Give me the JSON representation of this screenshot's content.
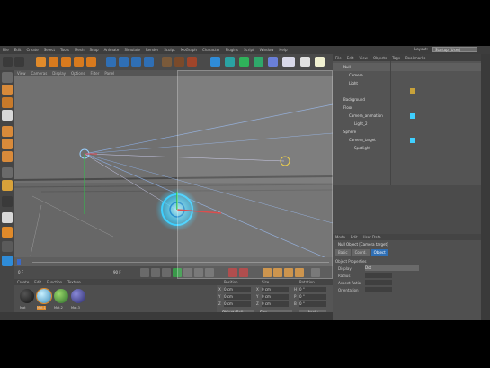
{
  "menubar": {
    "items": [
      "File",
      "Edit",
      "Create",
      "Select",
      "Tools",
      "Mesh",
      "Snap",
      "Animate",
      "Simulate",
      "Render",
      "Sculpt",
      "MoGraph",
      "Character",
      "Plugins",
      "Script",
      "Window",
      "Help"
    ],
    "layout_label": "Layout:",
    "layout_value": "Startup (User)"
  },
  "viewport": {
    "menu": [
      "View",
      "Cameras",
      "Display",
      "Options",
      "Filter",
      "Panel"
    ],
    "label": "Perspective"
  },
  "object_manager": {
    "menu": [
      "File",
      "Edit",
      "View",
      "Objects",
      "Tags",
      "Bookmarks"
    ],
    "rows": [
      "Null",
      "Camera",
      "Light",
      "Background",
      "Floor",
      "Camera_animation",
      "Light_2",
      "Sphere",
      "Camera_target",
      "Spotlight"
    ]
  },
  "attribute_manager": {
    "menu": [
      "Mode",
      "Edit",
      "User Data"
    ],
    "title": "Null Object [Camera target]",
    "tabs": [
      "Basic",
      "Coord.",
      "Object"
    ],
    "section": "Object Properties",
    "fields": [
      "Display",
      "Radius",
      "Aspect Ratio",
      "Orientation"
    ],
    "display_value": "Dot"
  },
  "material_manager": {
    "menu": [
      "Create",
      "Edit",
      "Function",
      "Texture"
    ],
    "materials": [
      "Mat",
      "Mat.1",
      "Mat.2",
      "Mat.3"
    ]
  },
  "coordinates": {
    "headers": [
      "Position",
      "Size",
      "Rotation"
    ],
    "rows": [
      [
        "X",
        "0 cm",
        "X",
        "0 cm",
        "H",
        "0 °"
      ],
      [
        "Y",
        "0 cm",
        "Y",
        "0 cm",
        "P",
        "0 °"
      ],
      [
        "Z",
        "0 cm",
        "Z",
        "0 cm",
        "B",
        "0 °"
      ]
    ],
    "mode_value": "Object (Rel)",
    "size_value": "Size",
    "apply_label": "Apply"
  },
  "timeline": {
    "start_frame": "0 F",
    "end_frame": "90 F"
  },
  "colors": {
    "accent": "#2f8cd8",
    "orange": "#e08a2a",
    "glow": "#3fd0ff"
  }
}
